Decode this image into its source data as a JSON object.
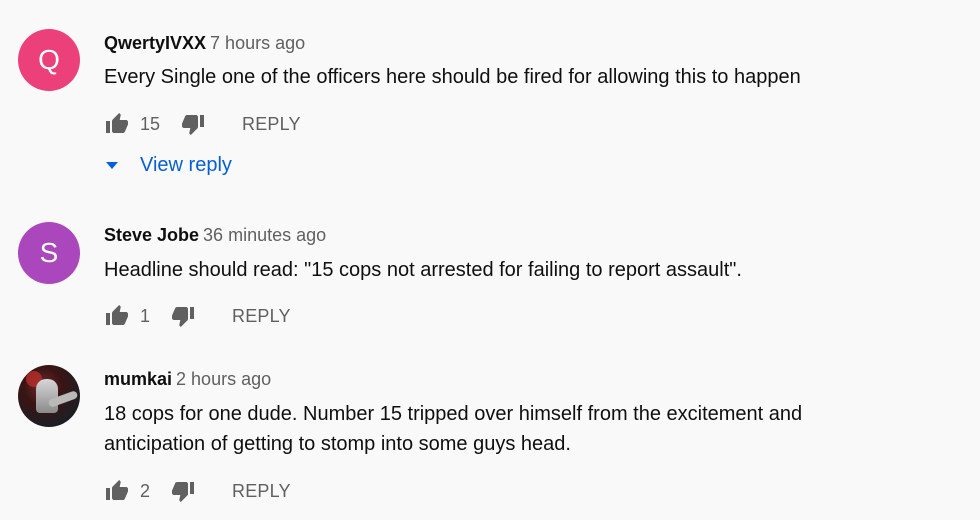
{
  "comments": [
    {
      "author": "QwertyIVXX",
      "time": "7 hours ago",
      "avatar_letter": "Q",
      "avatar_color": "#ec407a",
      "text": "Every Single one of the officers here should be fired for allowing this to happen",
      "likes": "15",
      "reply_label": "REPLY",
      "view_reply_label": "View reply"
    },
    {
      "author": "Steve Jobe",
      "time": "36 minutes ago",
      "avatar_letter": "S",
      "avatar_color": "#ab47bc",
      "text": "Headline should read: \"15 cops not arrested for failing to report assault\".",
      "likes": "1",
      "reply_label": "REPLY"
    },
    {
      "author": "mumkai",
      "time": "2 hours ago",
      "avatar_image": "profile photo",
      "text_line1": "18 cops for one dude. Number 15 tripped over himself from the excitement and",
      "text_line2": "anticipation of getting to stomp into some guys head.",
      "likes": "2",
      "reply_label": "REPLY"
    }
  ],
  "icons": {
    "like": "thumb-up-icon",
    "dislike": "thumb-down-icon",
    "expand": "caret-down-icon"
  },
  "colors": {
    "background": "#f9f9f9",
    "link": "#065fd4",
    "secondary_text": "#606060"
  }
}
